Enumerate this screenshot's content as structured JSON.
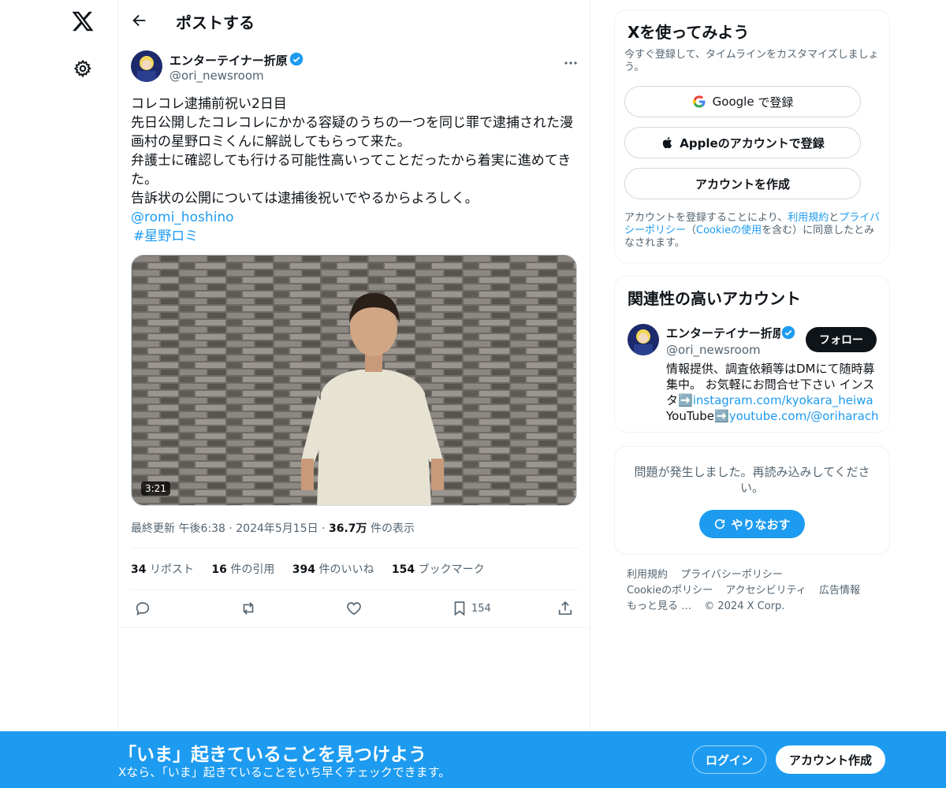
{
  "header": {
    "title": "ポストする"
  },
  "post": {
    "author_name": "エンターテイナー折原",
    "author_handle": "@ori_newsroom",
    "lines": [
      "コレコレ逮捕前祝い2日目",
      "先日公開したコレコレにかかる容疑のうちの一つを同じ罪で逮捕された漫",
      "画村の星野ロミくんに解説してもらって来た。",
      "弁護士に確認しても行ける可能性高いってことだったから着実に進めてき",
      "た。",
      "告訴状の公開については逮捕後祝いでやるからよろしく。"
    ],
    "mention": "@romi_hoshino",
    "hashtag": "#星野ロミ",
    "video_duration": "3:21",
    "meta": {
      "prefix": "最終更新 午後6:38",
      "sep": "·",
      "date": "2024年5月15日",
      "views": "36.7万",
      "views_suffix": "件の表示"
    },
    "stats": [
      {
        "value": "34",
        "label": "リポスト"
      },
      {
        "value": "16",
        "label": "件の引用"
      },
      {
        "value": "394",
        "label": "件のいいね"
      },
      {
        "value": "154",
        "label": "ブックマーク"
      }
    ],
    "bookmark_count": "154"
  },
  "signup_card": {
    "title": "Xを使ってみよう",
    "subtitle": "今すぐ登録して、タイムラインをカスタマイズしましょう。",
    "google_brand": "Google",
    "google_label": " で登録",
    "apple_label": "Appleのアカウントで登録",
    "create_label": "アカウントを作成",
    "terms_a": "アカウントを登録することにより、",
    "terms_link1": "利用規約",
    "terms_b": "と",
    "terms_link2": "プライバシーポリシー",
    "terms_c": "（",
    "terms_link3": "Cookieの使用",
    "terms_d": "を含む）に同意したとみなされます。"
  },
  "related": {
    "title": "関連性の高いアカウント",
    "name": "エンターテイナー折原",
    "handle": "@ori_newsroom",
    "follow": "フォロー",
    "bio_a": "情報提供、調査依頼等はDMにて随時募集中。 お気軽にお問合せ下さい インスタ",
    "arrow1": "➡️",
    "bio_link1": "instagram.com/kyokara_heiwa",
    "bio_b": " YouTube",
    "arrow2": "➡️",
    "bio_link2": "youtube.com/@oriharach"
  },
  "error_card": {
    "message": "問題が発生しました。再読み込みしてください。",
    "retry": "やりなおす"
  },
  "footer": {
    "links": [
      "利用規約",
      "プライバシーポリシー",
      "Cookieのポリシー",
      "アクセシビリティ",
      "広告情報",
      "もっと見る …",
      "© 2024 X Corp."
    ]
  },
  "banner": {
    "title": "「いま」起きていることを見つけよう",
    "subtitle": "Xなら、「いま」起きていることをいち早くチェックできます。",
    "login": "ログイン",
    "signup": "アカウント作成"
  },
  "colors": {
    "accent": "#1d9bf0",
    "text": "#0f1419",
    "muted": "#536471"
  },
  "icons": [
    "x-logo-icon",
    "gear-icon",
    "back-arrow-icon",
    "verified-badge-icon",
    "more-dots-icon",
    "reply-icon",
    "repost-icon",
    "like-icon",
    "bookmark-icon",
    "share-icon",
    "google-icon",
    "apple-icon",
    "refresh-icon"
  ]
}
